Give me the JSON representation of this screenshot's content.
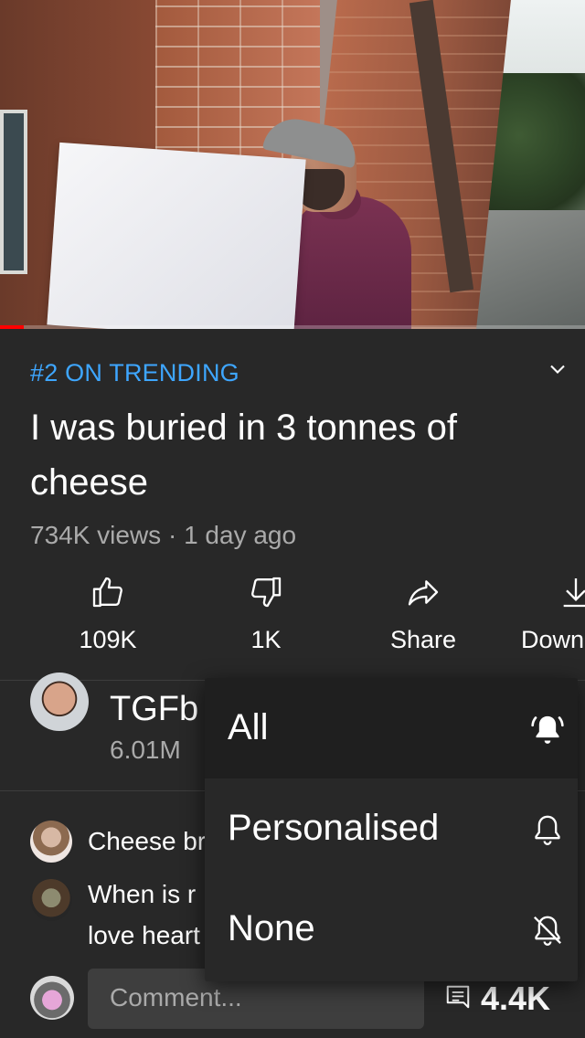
{
  "video": {
    "trending_label": "#2 ON TRENDING",
    "title": "I was buried in 3 tonnes of cheese",
    "views": "734K views",
    "age": "1 day ago",
    "progress_fraction": 0.04
  },
  "actions": {
    "like": "109K",
    "dislike": "1K",
    "share": "Share",
    "download": "Down"
  },
  "channel": {
    "name_visible": "TGFb",
    "subs_visible": "6.01M"
  },
  "comments": {
    "top_comment_line": "Cheese br",
    "second_comment_line1": "When is r",
    "second_comment_line2": "love heart",
    "placeholder": "Comment...",
    "count": "4.4K"
  },
  "notification_menu": {
    "items": [
      {
        "label": "All",
        "icon": "bell-ringing-filled-icon",
        "selected": true
      },
      {
        "label": "Personalised",
        "icon": "bell-outline-icon",
        "selected": false
      },
      {
        "label": "None",
        "icon": "bell-off-icon",
        "selected": false
      }
    ]
  },
  "colors": {
    "background": "#282828",
    "accent_link": "#3ea6ff",
    "progress": "#ff0000",
    "secondary_text": "#aaaaaa"
  }
}
